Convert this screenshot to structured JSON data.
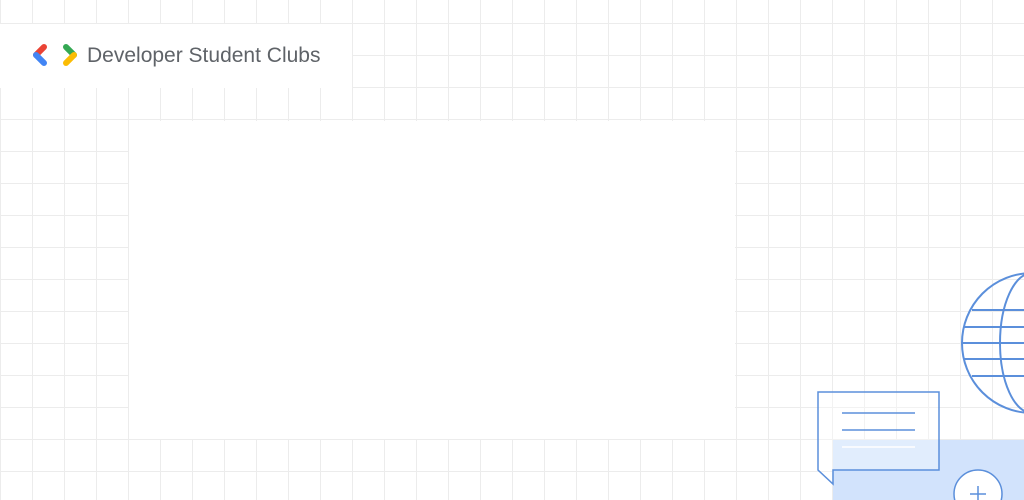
{
  "header": {
    "brand_name": "Developer Student Clubs",
    "logo_icon": "dsc-brackets-logo-icon"
  },
  "colors": {
    "logo_red": "#EA4335",
    "logo_blue": "#4285F4",
    "logo_green": "#34A853",
    "logo_yellow": "#FBBC04",
    "illustration_stroke": "#5B8FDB",
    "illustration_fill": "#D2E3FC",
    "grid": "#ECECEC"
  },
  "decorations": {
    "globe": "globe-icon",
    "chat": "chat-bubble-icon",
    "card": "add-card-icon"
  }
}
